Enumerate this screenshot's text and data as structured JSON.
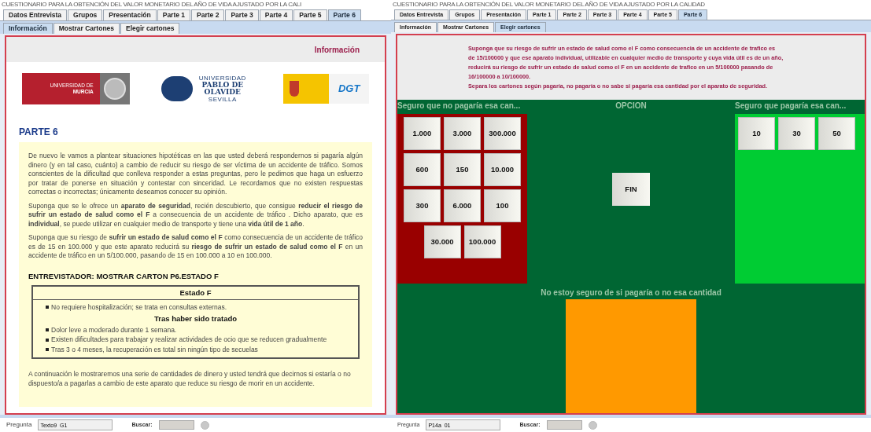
{
  "panels": [
    {
      "kind": "info",
      "title": "CUESTIONARIO PARA LA OBTENCIÓN DEL VALOR MONETARIO DEL AÑO DE VIDA AJUSTADO POR LA CALI",
      "tabs": [
        {
          "label": "Datos Entrevista",
          "selected": false
        },
        {
          "label": "Grupos",
          "selected": false
        },
        {
          "label": "Presentación",
          "selected": false
        },
        {
          "label": "Parte 1",
          "selected": false
        },
        {
          "label": "Parte 2",
          "selected": false
        },
        {
          "label": "Parte 3",
          "selected": false
        },
        {
          "label": "Parte 4",
          "selected": false
        },
        {
          "label": "Parte 5",
          "selected": false
        },
        {
          "label": "Parte 6",
          "selected": true
        }
      ],
      "subtabs": [
        {
          "label": "Información",
          "selected": true
        },
        {
          "label": "Mostrar Cartones",
          "selected": false
        },
        {
          "label": "Elegir cartones",
          "selected": false
        }
      ],
      "header": "Información",
      "logos": [
        {
          "kind": "murcia",
          "lines": [
            "UNIVERSIDAD DE",
            "MURCIA"
          ]
        },
        {
          "kind": "olavide",
          "lines": [
            "UNIVERSIDAD",
            "PABLO DE",
            "OLAVIDE",
            "SEVILLA"
          ]
        },
        {
          "kind": "dgt",
          "lines": [
            "DGT"
          ]
        }
      ],
      "heading": "PARTE 6",
      "paragraphs": [
        "De nuevo le vamos a plantear situaciones hipotéticas en las que usted deberá respondernos si pagaría algún dinero (y en tal caso, cuánto) a cambio de reducir su riesgo de ser víctima de un accidente de tráfico. Somos conscientes de la dificultad que conlleva responder a estas preguntas, pero le pedimos que haga un esfuerzo por tratar de ponerse en situación y contestar con sinceridad. Le recordamos que no existen respuestas correctas o incorrectas; únicamente deseamos conocer su opinión.",
        "Suponga que se le ofrece un **aparato de seguridad**, recién descubierto, que consigue **reducir el riesgo de sufrir un estado de salud como el F** a consecuencia de un accidente de tráfico . Dicho aparato, que es **individual**, se puede utilizar en cualquier medio de transporte y tiene una **vida útil de 1 año**.",
        "Suponga que su riesgo de **sufrir un estado de salud como el F** como consecuencia de un accidente de tráfico es de 15 en 100.000 y que este aparato reducirá su **riesgo de sufrir un estado de salud como el F** en un accidente de tráfico en un 5/100.000, pasando de 15 en 100.000 a 10 en 100.000."
      ],
      "instruction": "ENTREVISTADOR:  MOSTRAR CARTON P6.ESTADO F",
      "state_box": {
        "title": "Estado F",
        "items": [
          {
            "kind": "bullet",
            "text": "No requiere hospitalización; se trata en consultas externas."
          },
          {
            "kind": "subheading",
            "text": "Tras haber sido tratado"
          },
          {
            "kind": "bullet",
            "text": "Dolor leve a moderado durante 1 semana."
          },
          {
            "kind": "bullet",
            "text": "Existen dificultades para trabajar y realizar actividades de ocio que se reducen gradualmente"
          },
          {
            "kind": "bullet",
            "text": "Tras 3 o 4 meses, la recuperación es total sin ningún tipo de secuelas"
          }
        ]
      },
      "closing": "A continuación le mostraremos una serie de cantidades de dinero y usted tendrá que decirnos si estaría o no dispuesto/a a pagarlas a cambio de este aparato que reduce su riesgo de morir en un accidente.",
      "footer": {
        "question_label": "Pregunta",
        "question_value": "Texto9_G1",
        "search_label": "Buscar:"
      }
    },
    {
      "kind": "cards",
      "title": "CUESTIONARIO PARA LA OBTENCIÓN DEL VALOR MONETARIO DEL AÑO DE VIDA AJUSTADO POR LA CALIDAD",
      "tabs": [
        {
          "label": "Datos Entrevista",
          "selected": false
        },
        {
          "label": "Grupos",
          "selected": false
        },
        {
          "label": "Presentación",
          "selected": false
        },
        {
          "label": "Parte 1",
          "selected": false
        },
        {
          "label": "Parte 2",
          "selected": false
        },
        {
          "label": "Parte 3",
          "selected": false
        },
        {
          "label": "Parte 4",
          "selected": false
        },
        {
          "label": "Parte 5",
          "selected": false
        },
        {
          "label": "Parte 6",
          "selected": true
        }
      ],
      "subtabs": [
        {
          "label": "Información",
          "selected": false
        },
        {
          "label": "Mostrar Cartones",
          "selected": false
        },
        {
          "label": "Elegir cartones",
          "selected": true
        }
      ],
      "prompt_lines": [
        "Suponga que su riesgo de sufrir un estado de salud como el F como consecuencia de un accidente de trafico es",
        "de 15/100000 y que ese aparato individual, utilizable en cualquier medio de transporte y cuya vida útil es de un año,",
        "reducirá su riesgo de sufrir un estado de salud como el F en un accidente de trafico en  un 5/100000 pasando de",
        "16/100000 a 10/100000.",
        "Separa los cartones según pagaría, no pagaría o no sabe si pagaría esa cantidad por el aparato de seguridad."
      ],
      "columns": [
        {
          "kind": "no",
          "header": "Seguro que no pagaría esa can...",
          "cards": [
            "1.000",
            "3.000",
            "300.000",
            "600",
            "150",
            "10.000",
            "300",
            "6.000",
            "100",
            "30.000",
            "100.000"
          ]
        },
        {
          "kind": "option",
          "header": "OPCION",
          "button": "FIN"
        },
        {
          "kind": "yes",
          "header": "Seguro que pagaría esa can...",
          "cards": [
            "10",
            "30",
            "50"
          ]
        }
      ],
      "unsure": {
        "header": "No estoy seguro de si pagaría o no esa cantidad"
      },
      "footer": {
        "question_label": "Pregunta",
        "question_value": "P14a_01",
        "search_label": "Buscar:"
      }
    }
  ]
}
